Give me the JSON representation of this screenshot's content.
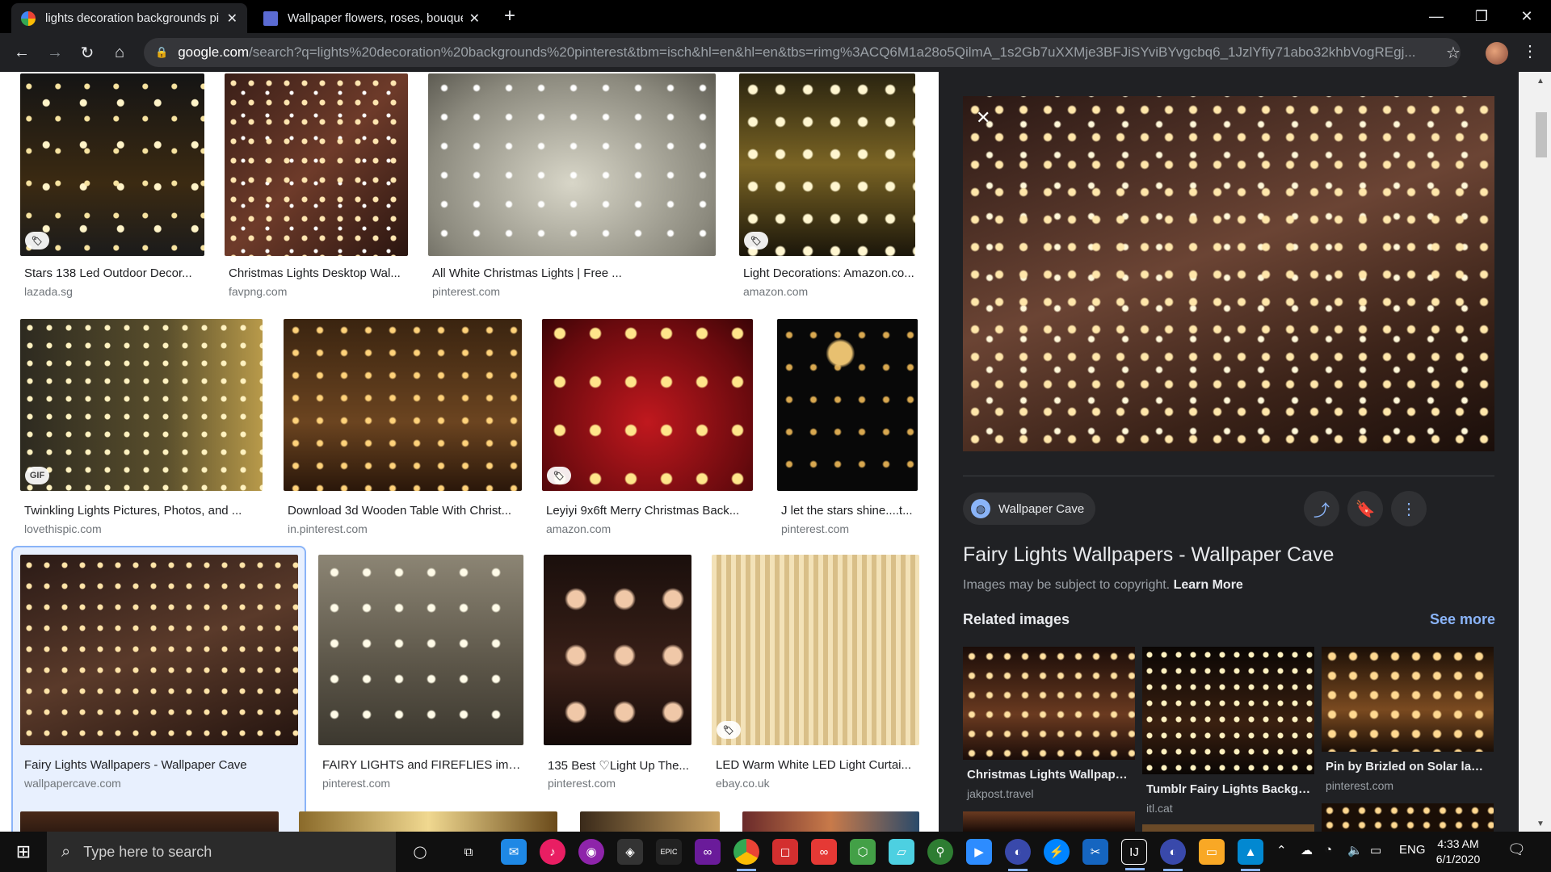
{
  "tabs": [
    {
      "title": "lights decoration backgrounds pi",
      "favicon": "google-icon"
    },
    {
      "title": "Wallpaper flowers, roses, bouque",
      "favicon": "gif-icon"
    }
  ],
  "url": {
    "domain": "google.com",
    "path": "/search?q=lights%20decoration%20backgrounds%20pinterest&tbm=isch&hl=en&hl=en&tbs=rimg%3ACQ6M1a28o5QilmA_1s2Gb7uXXMje3BFJiSYviBYvgcbq6_1JzlYfiy71abo32khbVogREgj..."
  },
  "results": [
    {
      "caption": "Stars 138 Led Outdoor Decor...",
      "source": "lazada.sg",
      "badge": "tag"
    },
    {
      "caption": "Christmas Lights Desktop Wal...",
      "source": "favpng.com",
      "badge": ""
    },
    {
      "caption": "All White Christmas Lights | Free ...",
      "source": "pinterest.com",
      "badge": ""
    },
    {
      "caption": "Light Decorations: Amazon.co...",
      "source": "amazon.com",
      "badge": "tag"
    },
    {
      "caption": "Twinkling Lights Pictures, Photos, and ...",
      "source": "lovethispic.com",
      "badge": "GIF"
    },
    {
      "caption": "Download 3d Wooden Table With Christ...",
      "source": "in.pinterest.com",
      "badge": ""
    },
    {
      "caption": "Leyiyi 9x6ft Merry Christmas Back...",
      "source": "amazon.com",
      "badge": "tag"
    },
    {
      "caption": "J let the stars shine....t...",
      "source": "pinterest.com",
      "badge": ""
    },
    {
      "caption": "Fairy Lights Wallpapers - Wallpaper Cave",
      "source": "wallpapercave.com",
      "badge": ""
    },
    {
      "caption": "FAIRY LIGHTS and FIREFLIES ima...",
      "source": "pinterest.com",
      "badge": ""
    },
    {
      "caption": "135 Best ♡Light Up The...",
      "source": "pinterest.com",
      "badge": ""
    },
    {
      "caption": "LED Warm White LED Light Curtai...",
      "source": "ebay.co.uk",
      "badge": "tag"
    }
  ],
  "panel": {
    "site": "Wallpaper Cave",
    "title": "Fairy Lights Wallpapers - Wallpaper Cave",
    "copyright": "Images may be subject to copyright.",
    "learn_more": "Learn More",
    "related_heading": "Related images",
    "see_more": "See more",
    "related": [
      {
        "caption": "Christmas Lights Wallpaper...",
        "source": "jakpost.travel"
      },
      {
        "caption": "Tumblr Fairy Lights Backgr...",
        "source": "itl.cat"
      },
      {
        "caption": "Pin by Brizled on Solar lamp...",
        "source": "pinterest.com"
      }
    ]
  },
  "taskbar": {
    "search_placeholder": "Type here to search",
    "lang": "ENG",
    "time": "4:33 AM",
    "date": "6/1/2020"
  }
}
